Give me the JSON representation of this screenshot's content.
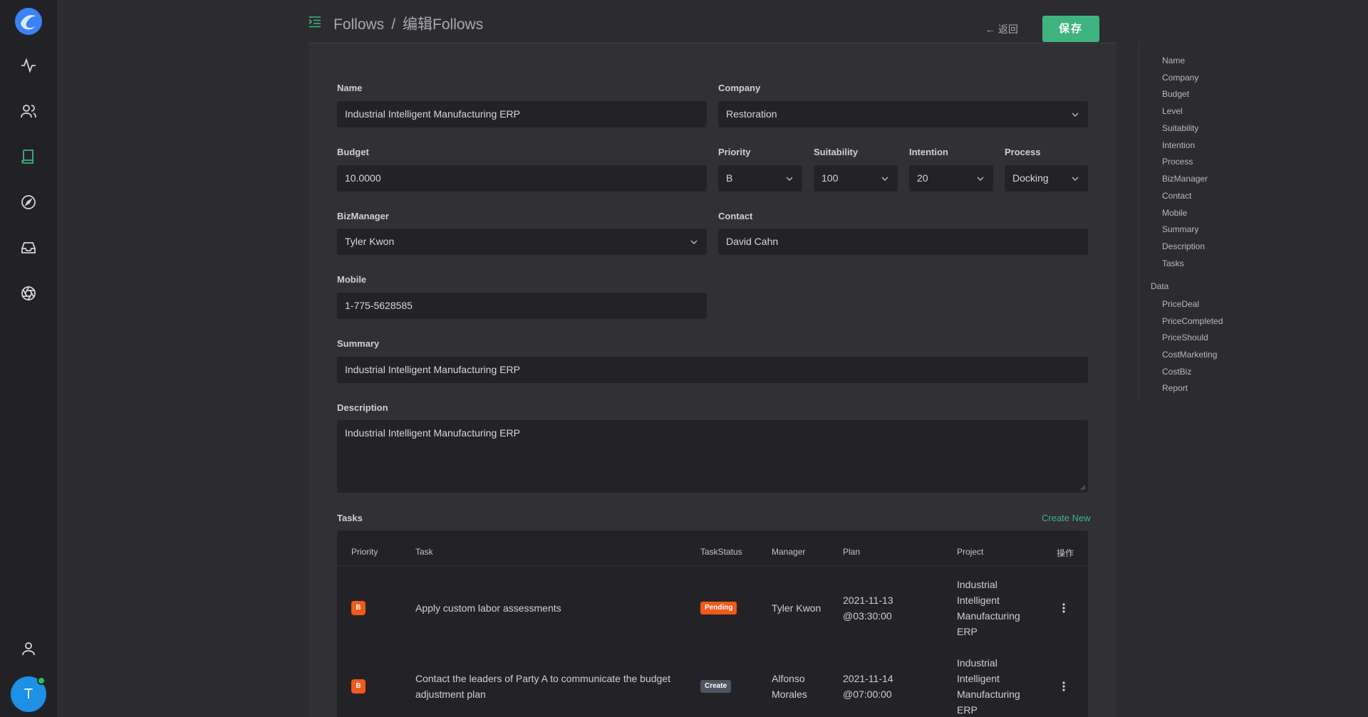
{
  "app": {
    "logo": "logo-icon",
    "avatar_initial": "T"
  },
  "nav": [
    {
      "icon": "activity-icon"
    },
    {
      "icon": "users-icon"
    },
    {
      "icon": "book-icon",
      "active": true
    },
    {
      "icon": "compass-icon"
    },
    {
      "icon": "inbox-icon"
    },
    {
      "icon": "aperture-icon"
    },
    {
      "icon": "user-icon"
    }
  ],
  "header": {
    "breadcrumb_root": "Follows",
    "breadcrumb_sep": "/",
    "breadcrumb_current": "编辑Follows",
    "back_label": "← 返回",
    "save_label": "保存"
  },
  "form": {
    "name": {
      "label": "Name",
      "value": "Industrial Intelligent Manufacturing ERP"
    },
    "company": {
      "label": "Company",
      "value": "Restoration"
    },
    "budget": {
      "label": "Budget",
      "value": "10.0000"
    },
    "priority": {
      "label": "Priority",
      "value": "B"
    },
    "suitability": {
      "label": "Suitability",
      "value": "100"
    },
    "intention": {
      "label": "Intention",
      "value": "20"
    },
    "process": {
      "label": "Process",
      "value": "Docking"
    },
    "bizmanager": {
      "label": "BizManager",
      "value": "Tyler Kwon"
    },
    "contact": {
      "label": "Contact",
      "value": "David Cahn"
    },
    "mobile": {
      "label": "Mobile",
      "value": "1-775-5628585"
    },
    "summary": {
      "label": "Summary",
      "value": "Industrial Intelligent Manufacturing ERP"
    },
    "description": {
      "label": "Description",
      "value": "Industrial Intelligent Manufacturing ERP"
    }
  },
  "tasks": {
    "title": "Tasks",
    "create_label": "Create New",
    "columns": [
      "Priority",
      "Task",
      "TaskStatus",
      "Manager",
      "Plan",
      "Project",
      "操作"
    ],
    "rows": [
      {
        "priority": "B",
        "task_line1": "Apply custom labor assessments",
        "task_line2": "",
        "status": "Pending",
        "status_color": "#f05a1a",
        "manager_line1": "Tyler Kwon",
        "manager_line2": "",
        "plan_line1": "2021-11-13",
        "plan_line2": "@03:30:00",
        "project": [
          "Industrial",
          "Intelligent",
          "Manufacturing",
          "ERP"
        ]
      },
      {
        "priority": "B",
        "task_line1": "Contact the leaders of Party A to communicate the budget",
        "task_line2": "adjustment plan",
        "status": "Create",
        "status_color": "#4b5563",
        "manager_line1": "Alfonso",
        "manager_line2": "Morales",
        "plan_line1": "2021-11-14",
        "plan_line2": "@07:00:00",
        "project": [
          "Industrial",
          "Intelligent",
          "Manufacturing",
          "ERP"
        ]
      }
    ]
  },
  "outline": {
    "items": [
      "Name",
      "Company",
      "Budget",
      "Level",
      "Suitability",
      "Intention",
      "Process",
      "BizManager",
      "Contact",
      "Mobile",
      "Summary",
      "Description",
      "Tasks"
    ],
    "group_label": "Data",
    "group_items": [
      "PriceDeal",
      "PriceCompleted",
      "PriceShould",
      "CostMarketing",
      "CostBiz",
      "Report"
    ]
  }
}
